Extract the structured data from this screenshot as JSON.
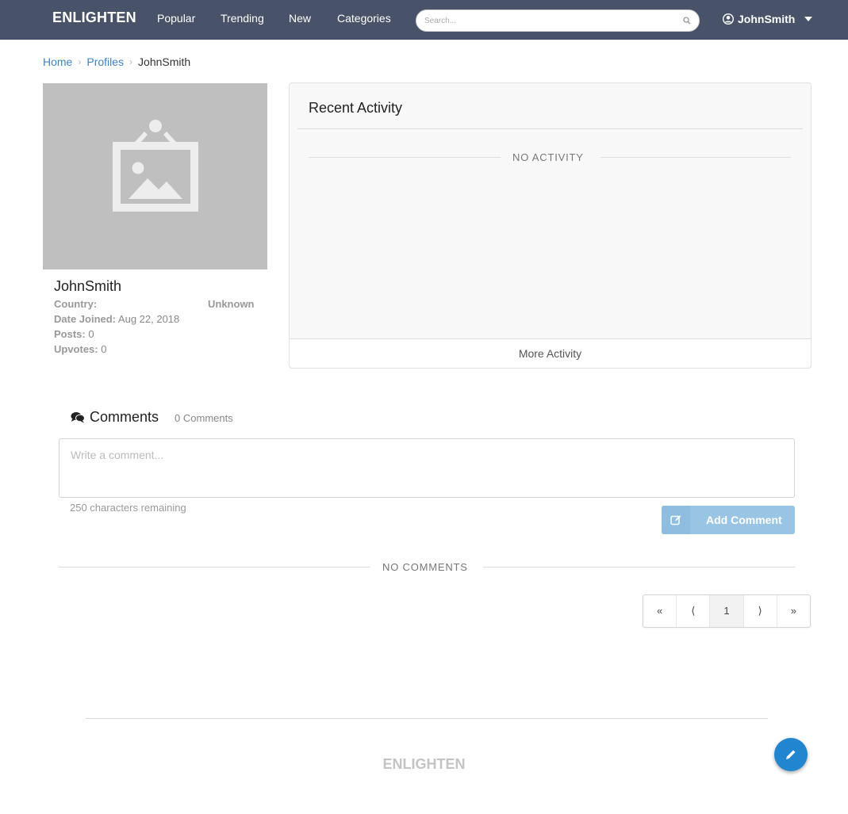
{
  "nav": {
    "brand": "ENLIGHTEN",
    "items": [
      {
        "label": "Popular"
      },
      {
        "label": "Trending"
      },
      {
        "label": "New"
      },
      {
        "label": "Categories"
      }
    ],
    "search_placeholder": "Search...",
    "user_name": "JohnSmith",
    "icons": {
      "search": "search-icon",
      "user": "user-circle-icon",
      "caret": "caret-down-icon"
    }
  },
  "breadcrumb": {
    "items": [
      {
        "label": "Home"
      },
      {
        "label": "Profiles"
      },
      {
        "label": "JohnSmith"
      }
    ]
  },
  "profile": {
    "avatar_icon": "image-placeholder-icon",
    "name": "JohnSmith",
    "country_label": "Country:",
    "country_value": "Unknown",
    "date_joined_label": "Date Joined:",
    "date_joined_value": "Aug 22, 2018",
    "posts_label": "Posts:",
    "posts_value": "0",
    "upvotes_label": "Upvotes:",
    "upvotes_value": "0"
  },
  "activity": {
    "title": "Recent Activity",
    "empty_text": "NO ACTIVITY",
    "more_label": "More Activity"
  },
  "comments": {
    "icon": "comments-icon",
    "title": "Comments",
    "count_text": "0 Comments",
    "input_placeholder": "Write a comment...",
    "input_value": "",
    "chars_remaining": "250 characters remaining",
    "add_button_label": "Add Comment",
    "add_button_icon": "edit-icon",
    "empty_text": "NO COMMENTS"
  },
  "pagination": {
    "first": "«",
    "prev": "⟨",
    "current": "1",
    "next": "⟩",
    "last": "»"
  },
  "footer": {
    "brand": "ENLIGHTEN"
  },
  "fab": {
    "icon": "pencil-icon"
  },
  "colors": {
    "navbar": "#48536a",
    "link": "#4183c4",
    "primary": "#2185d0",
    "button_disabled": "#9ac4e4"
  }
}
